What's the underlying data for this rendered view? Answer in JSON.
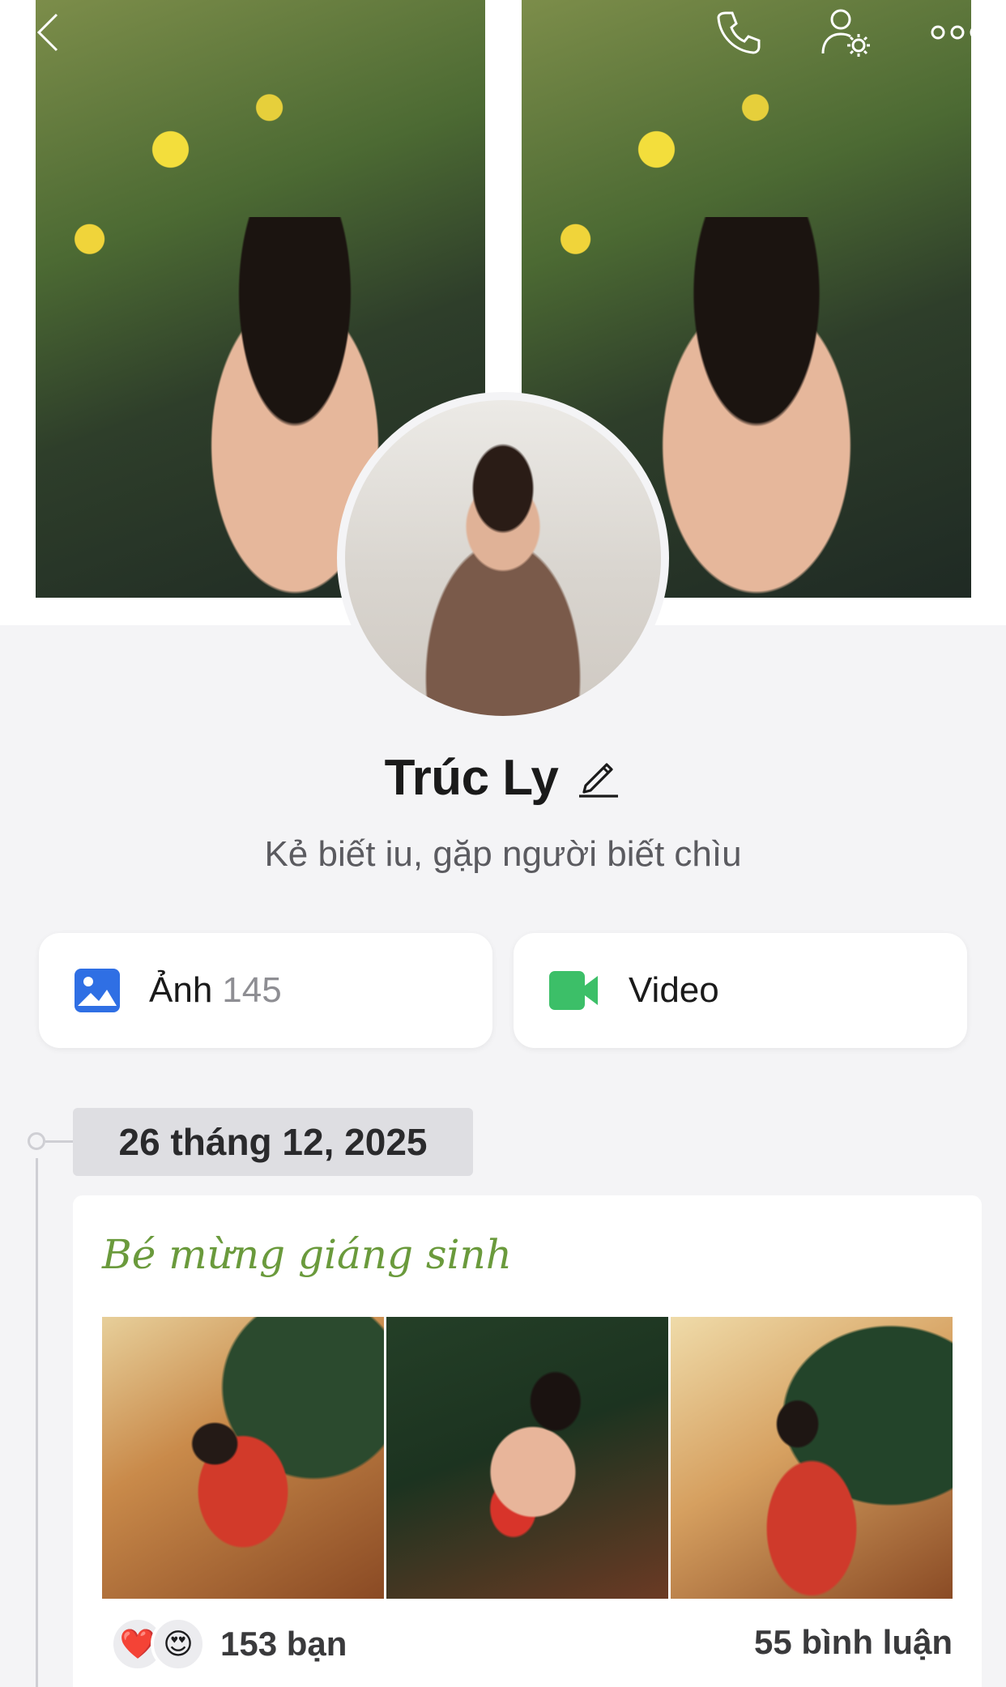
{
  "profile": {
    "name": "Trúc Ly",
    "bio": "Kẻ biết iu, gặp người biết chìu"
  },
  "media": {
    "photos_label": "Ảnh",
    "photos_count": "145",
    "video_label": "Video"
  },
  "timeline": {
    "date": "26 tháng 12, 2025",
    "post": {
      "caption": "Bé mừng giáng sinh",
      "reactions": [
        "❤️",
        "😍"
      ],
      "reaction_count": "153 bạn",
      "comment_count": "55 bình luận"
    }
  },
  "icons": {
    "back": "chevron-left-icon",
    "call": "phone-icon",
    "settings": "user-settings-icon",
    "more": "more-dots-icon",
    "edit": "pencil-icon",
    "photos": "image-icon",
    "video": "video-camera-icon"
  },
  "colors": {
    "photo_icon": "#2f6fe4",
    "video_icon": "#3cbf68",
    "caption": "#6a9a3c",
    "background": "#f4f4f6"
  }
}
